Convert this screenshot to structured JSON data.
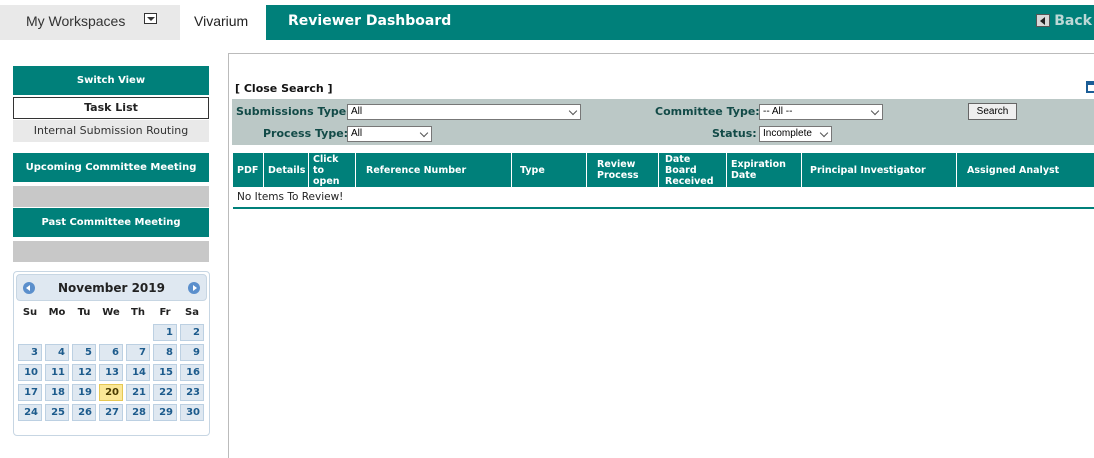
{
  "topbar": {
    "workspaces_label": "My Workspaces",
    "vivarium_label": "Vivarium",
    "page_title": "Reviewer Dashboard",
    "back_label": "Back"
  },
  "sidebar": {
    "switch_view": "Switch View",
    "task_list": "Task List",
    "internal_routing": "Internal Submission Routing",
    "upcoming_meeting": "Upcoming Committee Meeting",
    "past_meeting": "Past Committee Meeting"
  },
  "calendar": {
    "month_year": "November 2019",
    "weekdays": [
      "Su",
      "Mo",
      "Tu",
      "We",
      "Th",
      "Fr",
      "Sa"
    ],
    "days": [
      "1",
      "2",
      "3",
      "4",
      "5",
      "6",
      "7",
      "8",
      "9",
      "10",
      "11",
      "12",
      "13",
      "14",
      "15",
      "16",
      "17",
      "18",
      "19",
      "20",
      "21",
      "22",
      "23",
      "24",
      "25",
      "26",
      "27",
      "28",
      "29",
      "30"
    ],
    "leading_blanks": 5,
    "today": "20"
  },
  "search": {
    "close_label": "[ Close Search ]",
    "submissions_type_label": "Submissions Type:",
    "submissions_type_value": "All",
    "process_type_label": "Process Type:",
    "process_type_value": "All",
    "committee_type_label": "Committee Type:",
    "committee_type_value": "-- All --",
    "status_label": "Status:",
    "status_value": "Incomplete",
    "search_button": "Search"
  },
  "table": {
    "columns": [
      "PDF",
      "Details",
      "Click to open",
      "Reference Number",
      "Type",
      "Review Process",
      "Date Board Received",
      "Expiration Date",
      "Principal Investigator",
      "Assigned Analyst"
    ],
    "empty_message": "No Items To Review!"
  },
  "colors": {
    "teal": "#00807a",
    "panel": "#bbc8c6",
    "today_highlight": "#fbe797"
  }
}
